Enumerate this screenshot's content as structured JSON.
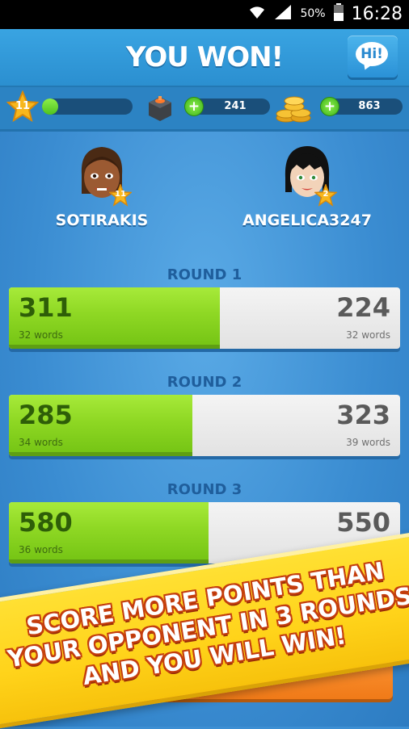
{
  "status_bar": {
    "battery_percent": "50%",
    "time": "16:28"
  },
  "header": {
    "title": "YOU WON!",
    "hi_label": "Hi!"
  },
  "stats": {
    "level": "11",
    "xp_progress": 0.18,
    "dice_count": "241",
    "coins_count": "863"
  },
  "players": [
    {
      "name": "SOTIRAKIS",
      "level": "11"
    },
    {
      "name": "ANGELICA3247",
      "level": "2"
    }
  ],
  "rounds": [
    {
      "label": "ROUND 1",
      "left_score": "311",
      "left_words": "32 words",
      "right_score": "224",
      "right_words": "32 words",
      "split": 0.54
    },
    {
      "label": "ROUND 2",
      "left_score": "285",
      "left_words": "34 words",
      "right_score": "323",
      "right_words": "39 words",
      "split": 0.47
    },
    {
      "label": "ROUND 3",
      "left_score": "580",
      "left_words": "36 words",
      "right_score": "550",
      "right_words": "",
      "split": 0.51
    }
  ],
  "banner": {
    "line1": "SCORE MORE POINTS THAN",
    "line2": "YOUR OPPONENT IN 3 ROUNDS",
    "line3": "AND YOU WILL WIN!"
  },
  "colors": {
    "win_green": "#8fd824",
    "background_blue": "#3d8fd3",
    "banner_yellow": "#ffd31a",
    "banner_text_outline": "#c43d0d"
  }
}
